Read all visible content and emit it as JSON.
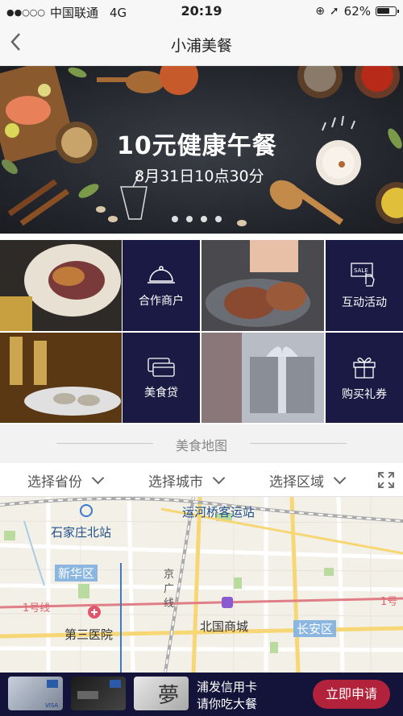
{
  "status_bar": {
    "carrier": "中国联通",
    "network": "4G",
    "time": "20:19",
    "battery": "62%"
  },
  "nav": {
    "title": "小浦美餐"
  },
  "banner": {
    "headline": "10元健康午餐",
    "subline": "8月31日10点30分",
    "pages": 4,
    "active_page": 1
  },
  "grid": {
    "items": [
      {
        "label": "合作商户",
        "icon": "cloche-icon"
      },
      {
        "label": "互动活动",
        "icon": "sale-tap-icon"
      },
      {
        "label": "美食贷",
        "icon": "card-icon"
      },
      {
        "label": "购买礼券",
        "icon": "gift-icon"
      }
    ]
  },
  "section": {
    "title": "美食地图"
  },
  "filters": {
    "province": "选择省份",
    "city": "选择城市",
    "district": "选择区域"
  },
  "map": {
    "labels": {
      "station_bus": "运河桥客运站",
      "station_north": "石家庄北站",
      "district_xinhua": "新华区",
      "road_jingguang": "京广线",
      "line1_left": "1号线",
      "line1_right": "1号",
      "hospital": "第三医院",
      "mall": "北国商城",
      "district_changan": "长安区"
    }
  },
  "ad": {
    "line1": "浦发信用卡",
    "line2": "请你吃大餐",
    "cta": "立即申请"
  },
  "colors": {
    "tile_bg": "#1b1a45",
    "ad_bg": "#14143a",
    "cta_bg": "#b3223b"
  }
}
